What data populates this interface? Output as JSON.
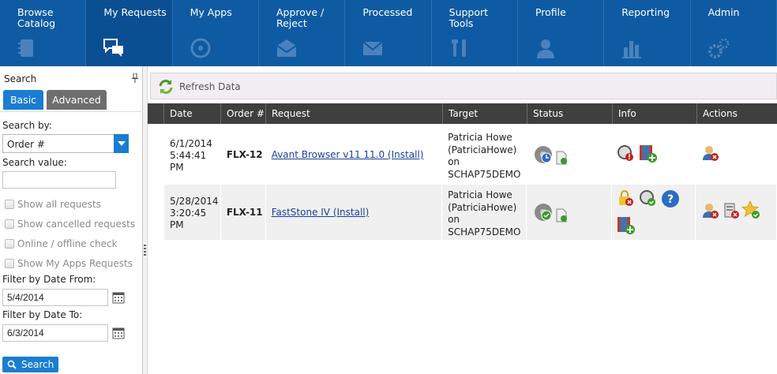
{
  "nav": {
    "items": [
      {
        "label": "Browse Catalog",
        "icon": "catalog-icon"
      },
      {
        "label": "My Requests",
        "icon": "chat-icon"
      },
      {
        "label": "My Apps",
        "icon": "disc-icon"
      },
      {
        "label": "Approve / Reject",
        "icon": "envelope-open-icon"
      },
      {
        "label": "Processed",
        "icon": "envelope-icon"
      },
      {
        "label": "Support Tools",
        "icon": "tools-icon"
      },
      {
        "label": "Profile",
        "icon": "person-icon"
      },
      {
        "label": "Reporting",
        "icon": "bar-chart-icon"
      },
      {
        "label": "Admin",
        "icon": "gears-icon"
      }
    ],
    "active": "My Requests"
  },
  "search_panel": {
    "title": "Search",
    "tabs": {
      "basic": "Basic",
      "advanced": "Advanced"
    },
    "search_by_label": "Search by:",
    "search_by_value": "Order #",
    "search_value_label": "Search value:",
    "search_value": "",
    "checkboxes": {
      "show_all": "Show all requests",
      "show_cancelled": "Show cancelled requests",
      "online_offline": "Online / offline check",
      "show_my_apps": "Show My Apps Requests"
    },
    "date_from_label": "Filter by Date From:",
    "date_from": "5/4/2014",
    "date_to_label": "Filter by Date To:",
    "date_to": "6/3/2014",
    "search_button": "Search"
  },
  "toolbar": {
    "refresh_label": "Refresh Data"
  },
  "grid": {
    "columns": {
      "date": "Date",
      "order": "Order #",
      "request": "Request",
      "target": "Target",
      "status": "Status",
      "info": "Info",
      "actions": "Actions"
    },
    "rows": [
      {
        "date_line1": "6/1/2014",
        "date_line2": "5:44:41",
        "date_line3": "PM",
        "order": "FLX-12",
        "request": "Avant Browser v11 11.0 (Install)",
        "target_line1": "Patricia Howe",
        "target_line2": "(PatriciaHowe)",
        "target_line3": "on",
        "target_line4": "SCHAP75DEMO"
      },
      {
        "date_line1": "5/28/2014",
        "date_line2": "3:20:45",
        "date_line3": "PM",
        "order": "FLX-11",
        "request": "FastStone IV (Install)",
        "target_line1": "Patricia Howe",
        "target_line2": "(PatriciaHowe)",
        "target_line3": "on",
        "target_line4": "SCHAP75DEMO"
      }
    ]
  },
  "colors": {
    "nav_bg": "#0f5ba3",
    "accent": "#1a7dd1",
    "grid_header": "#3f3f3f",
    "link": "#1a3f9a"
  }
}
